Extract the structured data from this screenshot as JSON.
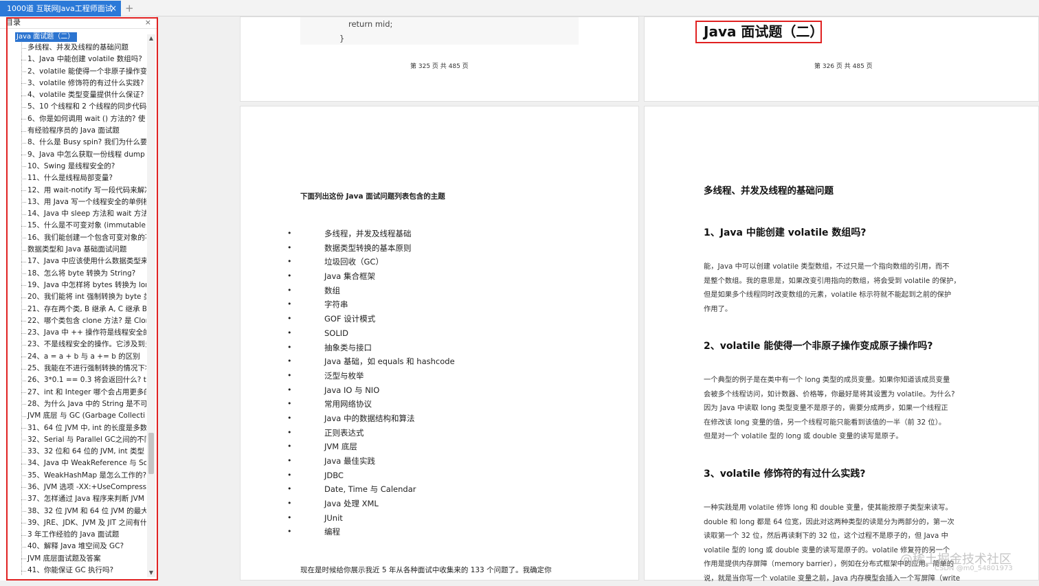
{
  "tab": {
    "title": "1000道 互联网Java工程师面试",
    "close": "×",
    "new_tab": "+"
  },
  "sidebar": {
    "header": "目录",
    "close": "×",
    "root": "Java 面试题（二）",
    "items": [
      "多线程、并发及线程的基础问题",
      "1、Java 中能创建 volatile 数组吗?",
      "2、volatile 能使得一个非原子操作变成",
      "3、volatile 修饰符的有过什么实践?",
      "4、volatile 类型变量提供什么保证?",
      "5、10 个线程和 2 个线程的同步代码,",
      "6、你是如何调用 wait () 方法的? 使",
      "有经验程序员的 Java 面试题",
      "8、什么是 Busy spin? 我们为什么要",
      "9、Java 中怎么获取一份线程 dump 文",
      "10、Swing 是线程安全的?",
      "11、什么是线程局部变量?",
      "12、用 wait-notify 写一段代码来解决",
      "13、用 Java 写一个线程安全的单例模",
      "14、Java 中 sleep 方法和 wait 方法",
      "15、什么是不可变对象 (immutable",
      "16、我们能创建一个包含可变对象的不",
      "数据类型和 Java 基础面试问题",
      "17、Java 中应该使用什么数据类型来",
      "18、怎么将 byte 转换为 String?",
      "19、Java 中怎样将 bytes 转换为 lon",
      "20、我们能将 int 强制转换为 byte 类",
      "21、存在两个类, B 继承 A, C 继承 B",
      "22、哪个类包含 clone 方法? 是 Clon",
      "23、Java 中 ++ 操作符是线程安全的",
      "23、不是线程安全的操作。它涉及到多",
      "24、a = a + b 与 a += b 的区别",
      "25、我能在不进行强制转换的情况下将",
      "26、3*0.1 == 0.3 将会返回什么? tru",
      "27、int 和 Integer 哪个会占用更多的",
      "28、为什么 Java 中的 String 是不可",
      "JVM 底层 与 GC (Garbage Collecti",
      "31、64 位 JVM 中, int 的长度是多数",
      "32、Serial 与 Parallel GC之间的不同",
      "33、32 位和 64 位的 JVM, int 类型",
      "34、Java 中 WeakReference 与 Sof",
      "35、WeakHashMap 是怎么工作的?",
      "36、JVM 选项 -XX:+UseCompresse",
      "37、怎样通过 Java 程序来判断 JVM",
      "38、32 位 JVM 和 64 位 JVM 的最大",
      "39、JRE、JDK、JVM 及 JIT 之间有什",
      "3 年工作经验的 Java 面试题",
      "40、解释 Java 堆空间及 GC?",
      "JVM 底层面试题及答案",
      "41、你能保证 GC 执行吗?"
    ]
  },
  "pages": {
    "p325": {
      "code_line1": "return mid;",
      "code_line2": "}",
      "page_num": "第 325 页 共 485 页"
    },
    "p326": {
      "title": "Java 面试题（二）",
      "page_num": "第 326 页 共 485 页"
    },
    "p327": {
      "lead": "下面列出这份 Java 面试问题列表包含的主题",
      "topics": [
        "多线程，并发及线程基础",
        "数据类型转换的基本原则",
        "垃圾回收（GC）",
        "Java 集合框架",
        "数组",
        "字符串",
        "GOF 设计模式",
        "SOLID",
        "抽象类与接口",
        "Java 基础，如 equals 和 hashcode",
        "泛型与枚举",
        "Java IO 与 NIO",
        "常用网络协议",
        "Java 中的数据结构和算法",
        "正则表达式",
        "JVM 底层",
        "Java 最佳实践",
        "JDBC",
        "Date, Time 与 Calendar",
        "Java 处理 XML",
        "JUnit",
        "编程"
      ],
      "bottom": "现在是时候给你展示我近 5 年从各种面试中收集来的 133 个问题了。我确定你"
    },
    "p328": {
      "section": "多线程、并发及线程的基础问题",
      "q1": "1、Java 中能创建 volatile 数组吗?",
      "a1": [
        "能，Java 中可以创建 volatile 类型数组，不过只是一个指向数组的引用，而不",
        "是整个数组。我的意思是，如果改变引用指向的数组，将会受到 volatile 的保护，",
        "但是如果多个线程同时改变数组的元素，volatile 标示符就不能起到之前的保护",
        "作用了。"
      ],
      "q2": "2、volatile 能使得一个非原子操作变成原子操作吗?",
      "a2": [
        "一个典型的例子是在类中有一个 long 类型的成员变量。如果你知道该成员变量",
        "会被多个线程访问，如计数器、价格等，你最好是将其设置为 volatile。为什么?",
        "因为 Java 中读取 long 类型变量不是原子的，需要分成两步，如果一个线程正",
        "在修改该 long 变量的值，另一个线程可能只能看到该值的一半（前 32 位）。",
        "但是对一个 volatile 型的 long 或 double 变量的读写是原子。"
      ],
      "q3": "3、volatile 修饰符的有过什么实践?",
      "a3": [
        "一种实践是用 volatile 修饰 long 和 double 变量，使其能按原子类型来读写。",
        "double 和 long 都是 64 位宽，因此对这两种类型的读是分为两部分的，第一次",
        "读取第一个 32 位，然后再读剩下的 32 位，这个过程不是原子的，但 Java 中",
        "volatile 型的 long 或 double 变量的读写是原子的。volatile 修复符的另一个",
        "作用是提供内存屏障（memory barrier），例如在分布式框架中的应用。简单的",
        "说，就是当你写一个 volatile 变量之前，Java 内存模型会插入一个写屏障（write"
      ],
      "watermark": "@稀土掘金技术社区",
      "watermark2": "CSDN @m0_54801973"
    }
  }
}
